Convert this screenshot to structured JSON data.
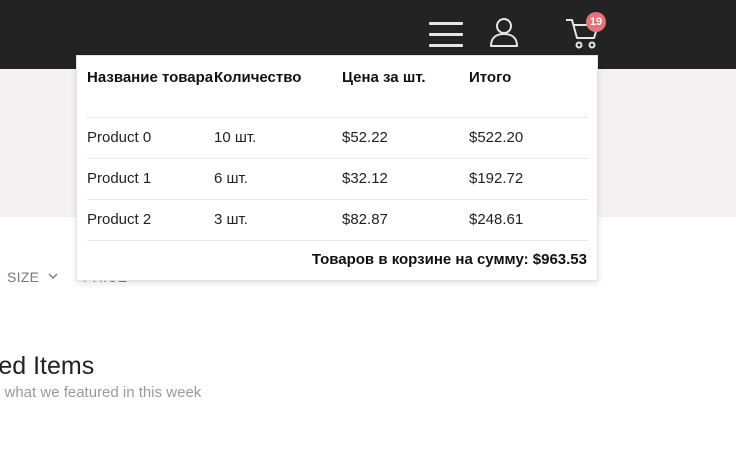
{
  "header": {
    "menu_icon": "hamburger-icon",
    "account_icon": "user-icon",
    "cart_icon": "cart-icon",
    "cart_count": "19",
    "badge_color": "#e8717a"
  },
  "cart": {
    "columns": [
      "Название товара",
      "Количество",
      "Цена за шт.",
      "Итого"
    ],
    "rows": [
      {
        "name": "Product 0",
        "qty": "10 шт.",
        "price": "$52.22",
        "total": "$522.20"
      },
      {
        "name": "Product 1",
        "qty": "6 шт.",
        "price": "$32.12",
        "total": "$192.72"
      },
      {
        "name": "Product 2",
        "qty": "3 шт.",
        "price": "$82.87",
        "total": "$248.61"
      }
    ],
    "total_label": "Товаров в корзине на сумму:",
    "total_value": "$963.53"
  },
  "filters": {
    "size_label": "SIZE",
    "price_label": "PRICE"
  },
  "featured": {
    "title": "red Items",
    "subtitle": "n what we featured in this week"
  }
}
